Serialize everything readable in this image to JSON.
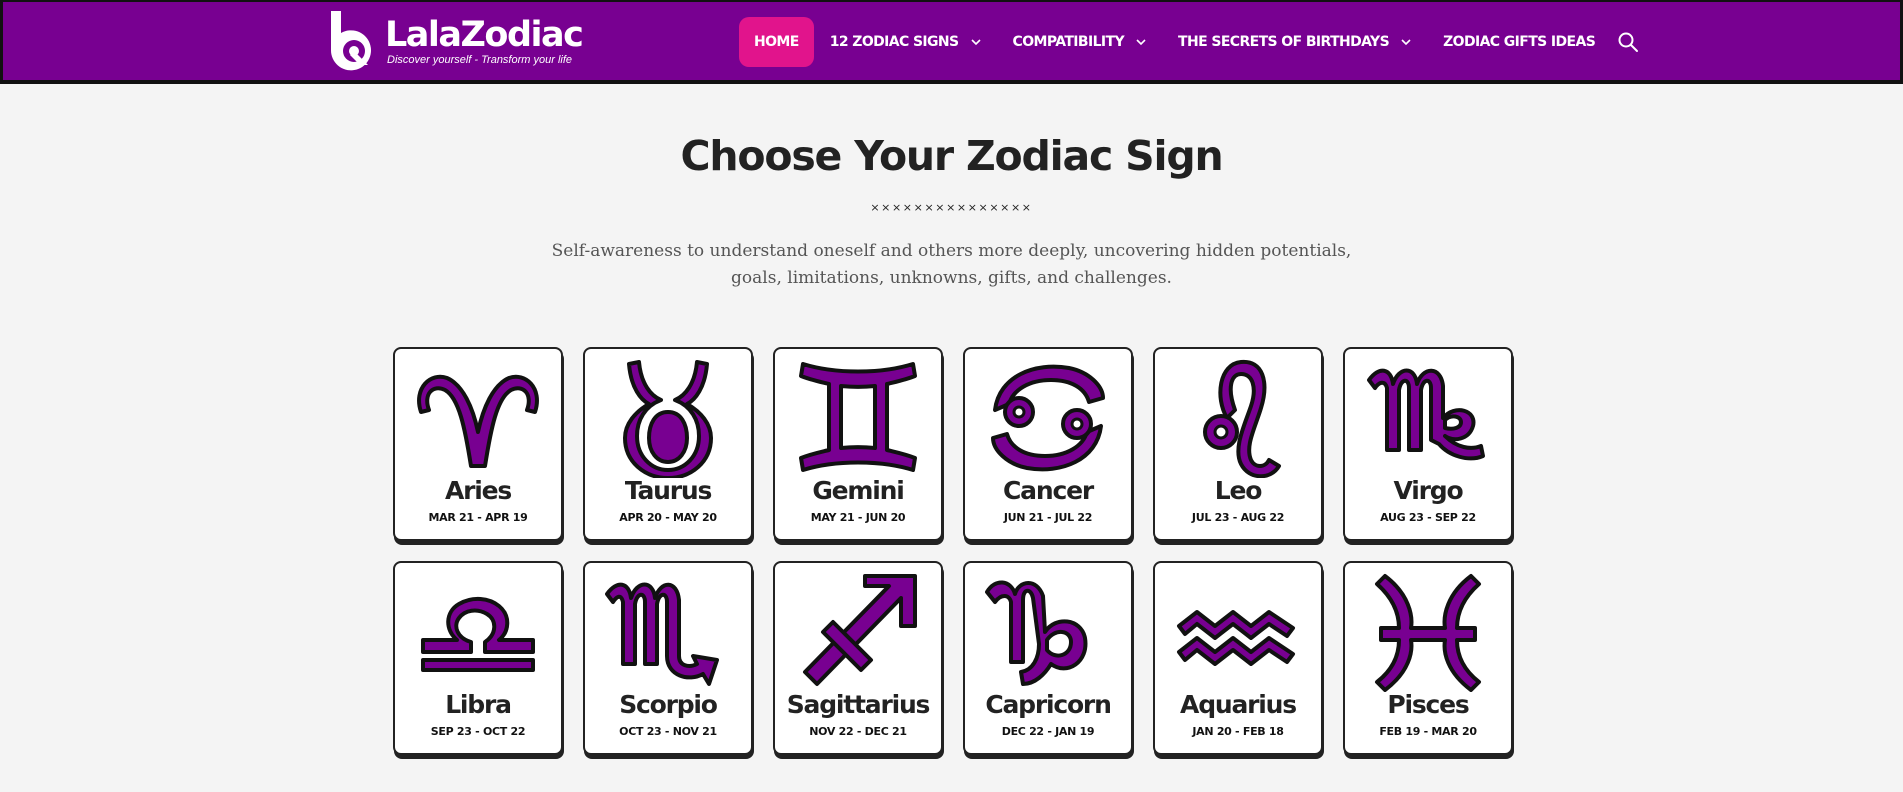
{
  "header": {
    "logo_name": "LalaZodiac",
    "logo_tagline": "Discover yourself - Transform your life",
    "nav": [
      {
        "label": "HOME",
        "active": true
      },
      {
        "label": "12 ZODIAC SIGNS",
        "dropdown": true
      },
      {
        "label": "COMPATIBILITY",
        "dropdown": true
      },
      {
        "label": "THE SECRETS OF BIRTHDAYS",
        "dropdown": true
      },
      {
        "label": "ZODIAC GIFTS IDEAS",
        "dropdown": false
      }
    ],
    "search_icon": "search-icon"
  },
  "main": {
    "title": "Choose Your Zodiac Sign",
    "divider": "×××××××××××××××",
    "description": "Self-awareness to understand oneself and others more deeply, uncovering hidden potentials, goals, limitations, unknowns, gifts, and challenges.",
    "signs": [
      {
        "name": "Aries",
        "dates": "MAR 21 - APR 19",
        "icon": "aries-icon"
      },
      {
        "name": "Taurus",
        "dates": "APR 20 - MAY 20",
        "icon": "taurus-icon"
      },
      {
        "name": "Gemini",
        "dates": "MAY 21 - JUN 20",
        "icon": "gemini-icon"
      },
      {
        "name": "Cancer",
        "dates": "JUN 21 - JUL 22",
        "icon": "cancer-icon"
      },
      {
        "name": "Leo",
        "dates": "JUL 23 - AUG 22",
        "icon": "leo-icon"
      },
      {
        "name": "Virgo",
        "dates": "AUG 23 - SEP 22",
        "icon": "virgo-icon"
      },
      {
        "name": "Libra",
        "dates": "SEP 23 - OCT 22",
        "icon": "libra-icon"
      },
      {
        "name": "Scorpio",
        "dates": "OCT 23 - NOV 21",
        "icon": "scorpio-icon"
      },
      {
        "name": "Sagittarius",
        "dates": "NOV 22 - DEC 21",
        "icon": "sagittarius-icon"
      },
      {
        "name": "Capricorn",
        "dates": "DEC 22 - JAN 19",
        "icon": "capricorn-icon"
      },
      {
        "name": "Aquarius",
        "dates": "JAN 20 - FEB 18",
        "icon": "aquarius-icon"
      },
      {
        "name": "Pisces",
        "dates": "FEB 19 - MAR 20",
        "icon": "pisces-icon"
      }
    ]
  },
  "colors": {
    "brand_purple": "#780091",
    "home_pink": "#e1148c",
    "background": "#f4f4f4",
    "text_dark": "#222222"
  }
}
